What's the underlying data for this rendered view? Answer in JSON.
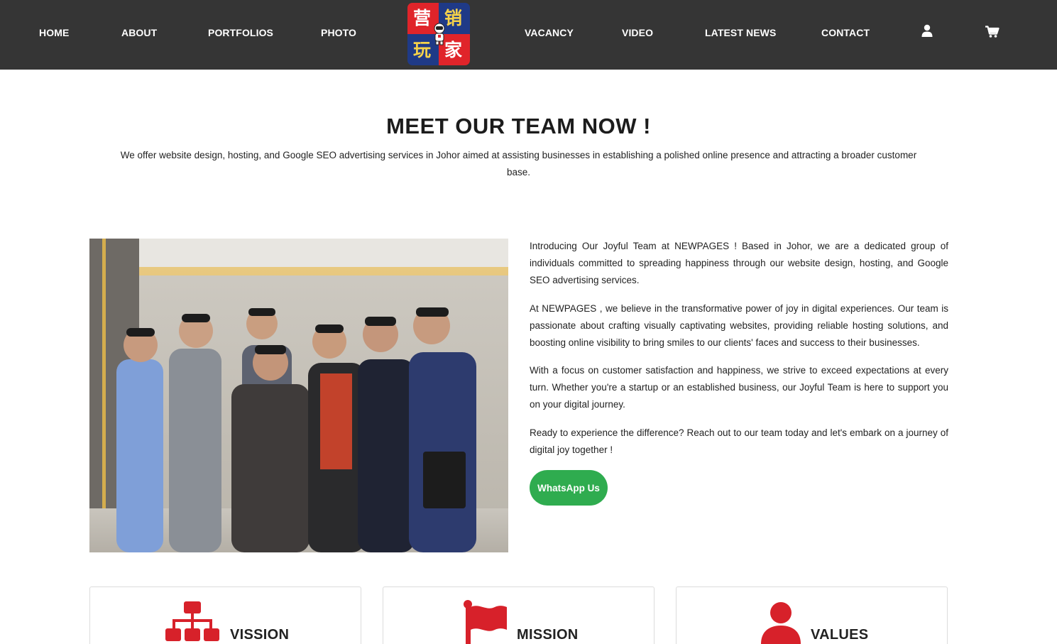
{
  "nav": {
    "items": [
      {
        "label": "HOME"
      },
      {
        "label": "ABOUT"
      },
      {
        "label": "PORTFOLIOS"
      },
      {
        "label": "PHOTO"
      },
      {
        "label": "VACANCY"
      },
      {
        "label": "VIDEO"
      },
      {
        "label": "LATEST NEWS"
      },
      {
        "label": "CONTACT"
      }
    ],
    "logo_chars": [
      "营",
      "销",
      "玩",
      "家"
    ],
    "icons": [
      "user-icon",
      "cart-icon"
    ]
  },
  "hero": {
    "title": "MEET OUR TEAM NOW !",
    "subtitle": "We offer website design, hosting, and Google SEO advertising services in Johor aimed at assisting businesses in establishing a polished online presence and attracting a broader customer base."
  },
  "about": {
    "paragraphs": [
      "Introducing Our Joyful Team at NEWPAGES ! Based in Johor, we are a dedicated group of individuals committed to spreading happiness through our website design, hosting, and Google SEO advertising services.",
      "At NEWPAGES , we believe in the transformative power of joy in digital experiences. Our team is passionate about crafting visually captivating websites, providing reliable hosting solutions, and boosting online visibility to bring smiles to our clients' faces and success to their businesses.",
      "With a focus on customer satisfaction and happiness, we strive to exceed expectations at every turn. Whether you're a startup or an established business, our Joyful Team is here to support you on your digital journey.",
      "Ready to experience the difference? Reach out to our team today and let's embark on a journey of digital joy together !"
    ],
    "whatsapp_label": "WhatsApp Us",
    "button_color": "#2fac4f"
  },
  "cards": [
    {
      "title": "VISSION",
      "icon": "org-chart-icon"
    },
    {
      "title": "MISSION",
      "icon": "flag-icon"
    },
    {
      "title": "VALUES",
      "icon": "person-icon"
    }
  ],
  "colors": {
    "nav_bg": "#353535",
    "accent_red": "#d7212a",
    "logo_blue": "#1f3a87"
  }
}
